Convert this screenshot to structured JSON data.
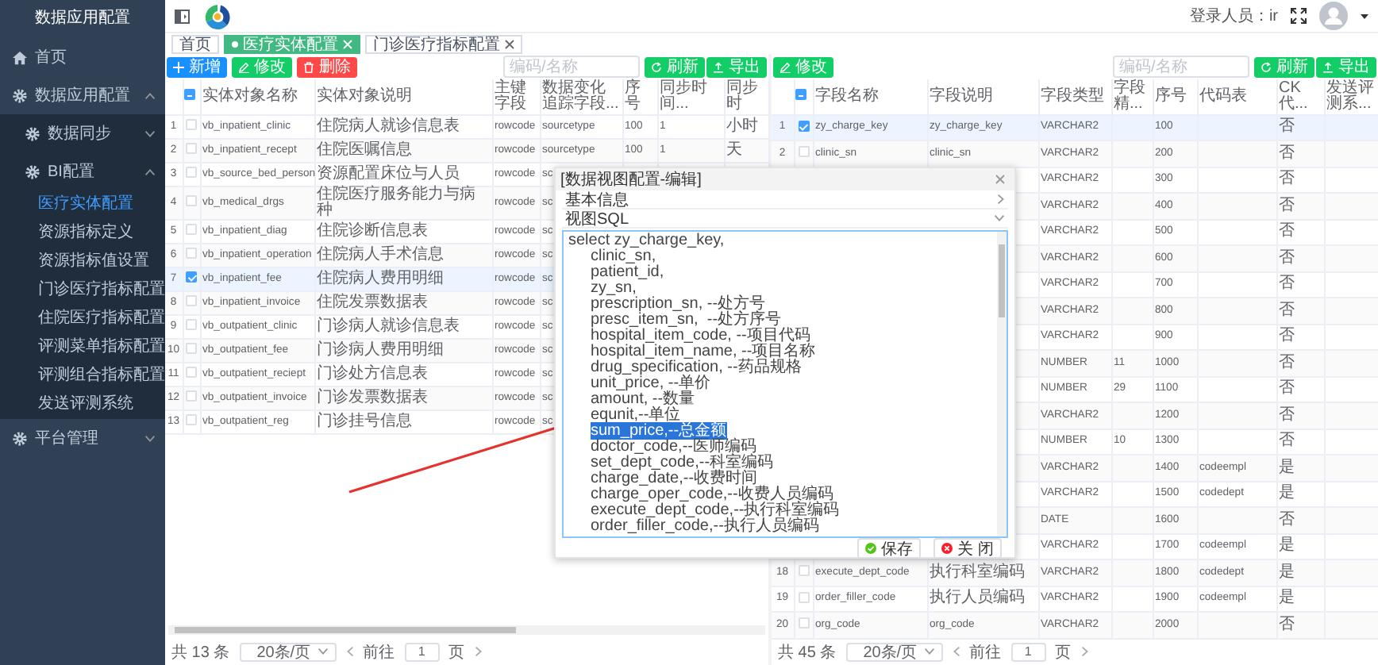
{
  "sidebar": {
    "title": "数据应用配置",
    "items": [
      {
        "label": "首页",
        "kind": "link",
        "selected": false
      },
      {
        "label": "数据应用配置",
        "kind": "menu",
        "expanded": true,
        "selected": false,
        "children": [
          {
            "label": "数据同步",
            "kind": "menu",
            "expanded": false,
            "selected": false
          },
          {
            "label": "BI配置",
            "kind": "menu",
            "expanded": true,
            "selected": false,
            "children": [
              {
                "label": "医疗实体配置",
                "kind": "page",
                "selected": true
              },
              {
                "label": "资源指标定义",
                "kind": "page",
                "selected": false
              },
              {
                "label": "资源指标值设置",
                "kind": "page",
                "selected": false
              },
              {
                "label": "门诊医疗指标配置",
                "kind": "page",
                "selected": false
              },
              {
                "label": "住院医疗指标配置",
                "kind": "page",
                "selected": false
              },
              {
                "label": "评测菜单指标配置",
                "kind": "page",
                "selected": false
              },
              {
                "label": "评测组合指标配置",
                "kind": "page",
                "selected": false
              },
              {
                "label": "发送评测系统",
                "kind": "page",
                "selected": false
              }
            ]
          }
        ]
      },
      {
        "label": "平台管理",
        "kind": "menu",
        "expanded": false,
        "selected": false
      }
    ]
  },
  "header": {
    "user": "登录人员：ir"
  },
  "tabs": [
    {
      "label": "首页",
      "selected": false,
      "closable": false
    },
    {
      "label": "医疗实体配置",
      "selected": true,
      "closable": true
    },
    {
      "label": "门诊医疗指标配置",
      "selected": false,
      "closable": true
    }
  ],
  "left_panel": {
    "buttons": [
      {
        "label": "新增",
        "kind": "add"
      },
      {
        "label": "修改",
        "kind": "edit"
      },
      {
        "label": "删除",
        "kind": "delete"
      }
    ],
    "search": {
      "placeholder": "编码/名称"
    },
    "actions": [
      {
        "label": "刷新",
        "kind": "refresh"
      },
      {
        "label": "导出",
        "kind": "export"
      }
    ],
    "table": {
      "header_checkbox": {
        "indeterminate": true
      },
      "columns": [
        "实体对象名称",
        "实体对象说明",
        "主键字段",
        "数据变化追踪字段...",
        "序号",
        "同步时间...",
        "同步时"
      ],
      "rows": [
        {
          "index": "1",
          "checked": false,
          "cells": [
            "vb_inpatient_clinic",
            "住院病人就诊信息表",
            "rowcode",
            "sourcetype",
            "100",
            "1",
            "小时"
          ]
        },
        {
          "index": "2",
          "checked": false,
          "cells": [
            "vb_inpatient_recept",
            "住院医嘱信息",
            "rowcode",
            "sourcetype",
            "100",
            "1",
            "天"
          ]
        },
        {
          "index": "3",
          "checked": false,
          "cells": [
            "vb_source_bed_person",
            "资源配置床位与人员",
            "rowcode",
            "sc"
          ]
        },
        {
          "index": "4",
          "checked": false,
          "cells": [
            "vb_medical_drgs",
            "住院医疗服务能力与病种",
            "rowcode",
            "sc"
          ]
        },
        {
          "index": "5",
          "checked": false,
          "cells": [
            "vb_inpatient_diag",
            "住院诊断信息表",
            "rowcode",
            "sc"
          ]
        },
        {
          "index": "6",
          "checked": false,
          "cells": [
            "vb_inpatient_operation",
            "住院病人手术信息",
            "rowcode",
            "sc"
          ]
        },
        {
          "index": "7",
          "checked": true,
          "cells": [
            "vb_inpatient_fee",
            "住院病人费用明细",
            "rowcode",
            "sc"
          ]
        },
        {
          "index": "8",
          "checked": false,
          "cells": [
            "vb_inpatient_invoice",
            "住院发票数据表",
            "rowcode",
            "sc"
          ]
        },
        {
          "index": "9",
          "checked": false,
          "cells": [
            "vb_outpatient_clinic",
            "门诊病人就诊信息表",
            "rowcode",
            "sc"
          ]
        },
        {
          "index": "10",
          "checked": false,
          "cells": [
            "vb_outpatient_fee",
            "门诊病人费用明细",
            "rowcode",
            "sc"
          ]
        },
        {
          "index": "11",
          "checked": false,
          "cells": [
            "vb_outpatient_reciept",
            "门诊处方信息表",
            "rowcode",
            "sc"
          ]
        },
        {
          "index": "12",
          "checked": false,
          "cells": [
            "vb_outpatient_invoice",
            "门诊发票数据表",
            "rowcode",
            "sc"
          ]
        },
        {
          "index": "13",
          "checked": false,
          "cells": [
            "vb_outpatient_reg",
            "门诊挂号信息",
            "rowcode",
            "sc"
          ]
        }
      ]
    },
    "footer": {
      "total": "共 13 条",
      "page_size": "20条/页",
      "goto": "前往",
      "page": "1",
      "page_unit": "页"
    }
  },
  "right_panel": {
    "buttons": [
      {
        "label": "修改",
        "kind": "edit"
      }
    ],
    "search": {
      "placeholder": "编码/名称"
    },
    "actions": [
      {
        "label": "刷新",
        "kind": "refresh"
      },
      {
        "label": "导出",
        "kind": "export"
      }
    ],
    "table": {
      "header_checkbox": {
        "indeterminate": true
      },
      "columns": [
        "字段名称",
        "字段说明",
        "字段类型",
        "字段精...",
        "序号",
        "代码表",
        "CK代...",
        "发送评测系..."
      ],
      "rows": [
        {
          "index": "1",
          "checked": true,
          "cells": [
            "zy_charge_key",
            "zy_charge_key",
            "VARCHAR2",
            null,
            "100",
            null,
            "否",
            null
          ]
        },
        {
          "index": "2",
          "checked": false,
          "cells": [
            "clinic_sn",
            "clinic_sn",
            "VARCHAR2",
            null,
            "200",
            null,
            "否",
            null
          ]
        },
        {
          "cells": [
            null,
            null,
            "VARCHAR2",
            null,
            "300",
            null,
            "否",
            null
          ]
        },
        {
          "cells": [
            null,
            null,
            "VARCHAR2",
            null,
            "400",
            null,
            "否",
            null
          ]
        },
        {
          "cells": [
            null,
            null,
            "VARCHAR2",
            null,
            "500",
            null,
            "否",
            null
          ]
        },
        {
          "cells": [
            null,
            null,
            "VARCHAR2",
            null,
            "600",
            null,
            "否",
            null
          ]
        },
        {
          "cells": [
            null,
            null,
            "VARCHAR2",
            null,
            "700",
            null,
            "否",
            null
          ]
        },
        {
          "cells": [
            null,
            null,
            "VARCHAR2",
            null,
            "800",
            null,
            "否",
            null
          ]
        },
        {
          "cells": [
            null,
            null,
            "VARCHAR2",
            null,
            "900",
            null,
            "否",
            null
          ]
        },
        {
          "cells": [
            null,
            null,
            "NUMBER",
            "11",
            "1000",
            null,
            "否",
            null
          ]
        },
        {
          "cells": [
            null,
            null,
            "NUMBER",
            "29",
            "1100",
            null,
            "否",
            null
          ]
        },
        {
          "cells": [
            null,
            null,
            "VARCHAR2",
            null,
            "1200",
            null,
            "否",
            null
          ]
        },
        {
          "cells": [
            null,
            null,
            "NUMBER",
            "10",
            "1300",
            null,
            "否",
            null
          ]
        },
        {
          "cells": [
            null,
            null,
            "VARCHAR2",
            null,
            "1400",
            "codeempl",
            "是",
            null
          ]
        },
        {
          "cells": [
            null,
            null,
            "VARCHAR2",
            null,
            "1500",
            "codedept",
            "是",
            null
          ]
        },
        {
          "cells": [
            null,
            null,
            "DATE",
            null,
            "1600",
            null,
            "否",
            null
          ]
        },
        {
          "cells": [
            null,
            null,
            "VARCHAR2",
            null,
            "1700",
            "codeempl",
            "是",
            null
          ]
        },
        {
          "index": "18",
          "checked": false,
          "cells": [
            "execute_dept_code",
            "执行科室编码",
            "VARCHAR2",
            null,
            "1800",
            "codedept",
            "是",
            null
          ]
        },
        {
          "index": "19",
          "checked": false,
          "cells": [
            "order_filler_code",
            "执行人员编码",
            "VARCHAR2",
            null,
            "1900",
            "codeempl",
            "是",
            null
          ]
        },
        {
          "index": "20",
          "checked": false,
          "cells": [
            "org_code",
            "org_code",
            "VARCHAR2",
            null,
            "2000",
            null,
            "否",
            null
          ]
        }
      ]
    },
    "footer": {
      "total": "共 45 条",
      "page_size": "20条/页",
      "goto": "前往",
      "page": "1",
      "page_unit": "页"
    }
  },
  "modal": {
    "title": "[数据视图配置-编辑]",
    "sections": [
      {
        "label": "基本信息",
        "expanded": false
      },
      {
        "label": "视图SQL",
        "expanded": true
      }
    ],
    "sql_head": "select zy_charge_key,",
    "sql_fields": [
      {
        "text": "clinic_sn,",
        "selected": false
      },
      {
        "text": "patient_id,",
        "selected": false
      },
      {
        "text": "zy_sn,",
        "selected": false
      },
      {
        "text": "prescription_sn, --处方号",
        "selected": false
      },
      {
        "text": "presc_item_sn,  --处方序号",
        "selected": false
      },
      {
        "text": "hospital_item_code, --项目代码",
        "selected": false
      },
      {
        "text": "hospital_item_name, --项目名称",
        "selected": false
      },
      {
        "text": "drug_specification, --药品规格",
        "selected": false
      },
      {
        "text": "unit_price, --单价",
        "selected": false
      },
      {
        "text": "amount, --数量",
        "selected": false
      },
      {
        "text": "equnit,--单位",
        "selected": false
      },
      {
        "text": "sum_price,--总金额",
        "selected": true
      },
      {
        "text": "doctor_code,--医师编码",
        "selected": false
      },
      {
        "text": "set_dept_code,--科室编码",
        "selected": false
      },
      {
        "text": "charge_date,--收费时间",
        "selected": false
      },
      {
        "text": "charge_oper_code,--收费人员编码",
        "selected": false
      },
      {
        "text": "execute_dept_code,--执行科室编码",
        "selected": false
      },
      {
        "text": "order_filler_code,--执行人员编码",
        "selected": false
      }
    ],
    "buttons": [
      {
        "label": "保存",
        "kind": "save"
      },
      {
        "label": "关 闭",
        "kind": "close"
      }
    ]
  }
}
